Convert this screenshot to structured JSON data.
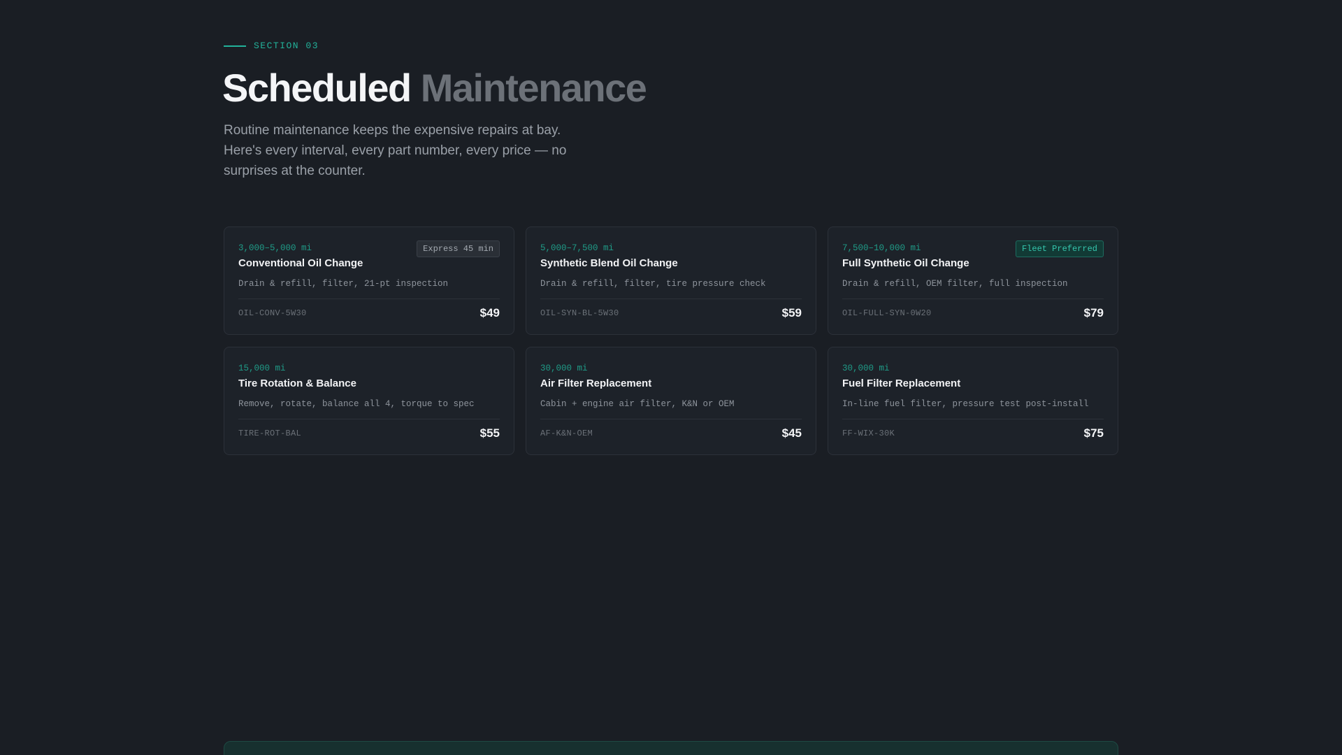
{
  "section": {
    "eyebrow": "SECTION 03",
    "title_main": "Scheduled",
    "title_accent": "Maintenance",
    "subtitle": "Routine maintenance keeps the expensive repairs at bay. Here's every interval, every part number, every price — no surprises at the counter."
  },
  "services": [
    {
      "interval": "3,000–5,000 mi",
      "name": "Conventional Oil Change",
      "description": "Drain & refill, filter, 21-pt inspection",
      "sku": "OIL-CONV-5W30",
      "price": "$49",
      "badge": "Express 45 min",
      "badge_style": "neutral"
    },
    {
      "interval": "5,000–7,500 mi",
      "name": "Synthetic Blend Oil Change",
      "description": "Drain & refill, filter, tire pressure check",
      "sku": "OIL-SYN-BL-5W30",
      "price": "$59",
      "badge": "",
      "badge_style": ""
    },
    {
      "interval": "7,500–10,000 mi",
      "name": "Full Synthetic Oil Change",
      "description": "Drain & refill, OEM filter, full inspection",
      "sku": "OIL-FULL-SYN-0W20",
      "price": "$79",
      "badge": "Fleet Preferred",
      "badge_style": "accent"
    },
    {
      "interval": "15,000 mi",
      "name": "Tire Rotation & Balance",
      "description": "Remove, rotate, balance all 4, torque to spec",
      "sku": "TIRE-ROT-BAL",
      "price": "$55",
      "badge": "",
      "badge_style": ""
    },
    {
      "interval": "30,000 mi",
      "name": "Air Filter Replacement",
      "description": "Cabin + engine air filter, K&N or OEM",
      "sku": "AF-K&N-OEM",
      "price": "$45",
      "badge": "",
      "badge_style": ""
    },
    {
      "interval": "30,000 mi",
      "name": "Fuel Filter Replacement",
      "description": "In-line fuel filter, pressure test post-install",
      "sku": "FF-WIX-30K",
      "price": "$75",
      "badge": "",
      "badge_style": ""
    }
  ],
  "colors": {
    "background": "#1a1e24",
    "accent": "#22b29a",
    "card_background": "#1d2229",
    "card_border": "#2c3139"
  }
}
